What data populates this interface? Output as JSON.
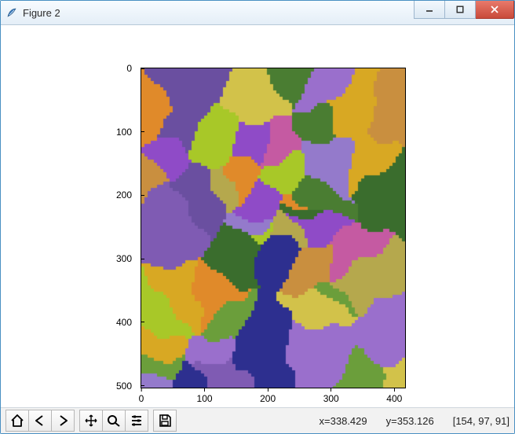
{
  "window": {
    "title": "Figure 2",
    "icon": "tk-feather-icon"
  },
  "titlebar_buttons": {
    "minimize": "minimize",
    "maximize": "maximize",
    "close": "close"
  },
  "axes": {
    "x_ticks": [
      0,
      100,
      200,
      300,
      400
    ],
    "y_ticks": [
      0,
      100,
      200,
      300,
      400,
      500
    ],
    "x_range": [
      0,
      417
    ],
    "y_range": [
      0,
      503
    ]
  },
  "toolbar": {
    "home": "Home",
    "back": "Back",
    "forward": "Forward",
    "pan": "Pan",
    "zoom": "Zoom",
    "configure": "Configure subplots",
    "save": "Save"
  },
  "status": {
    "x_label": "x=338.429",
    "y_label": "y=353.126",
    "pixel": "[154, 97, 91]"
  }
}
